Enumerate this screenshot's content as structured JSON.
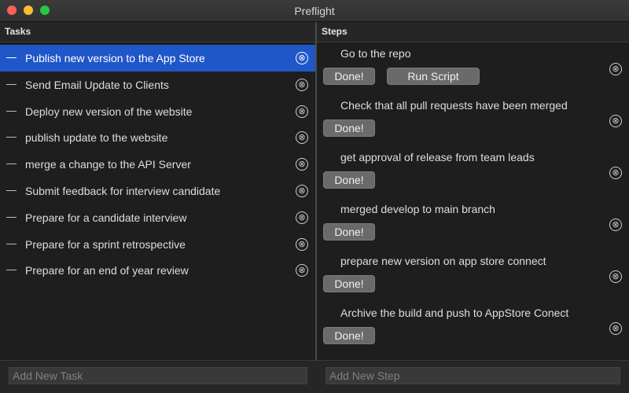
{
  "window": {
    "title": "Preflight"
  },
  "tasks_pane": {
    "header": "Tasks",
    "items": [
      {
        "label": "Publish new version to the App Store",
        "selected": true
      },
      {
        "label": "Send Email Update to Clients"
      },
      {
        "label": "Deploy new version of the website"
      },
      {
        "label": "publish update to the website"
      },
      {
        "label": "merge a change to the API Server"
      },
      {
        "label": "Submit feedback for interview candidate"
      },
      {
        "label": "Prepare for a candidate interview"
      },
      {
        "label": "Prepare for a sprint retrospective"
      },
      {
        "label": "Prepare for an end of year review"
      }
    ],
    "new_placeholder": "Add New Task"
  },
  "steps_pane": {
    "header": "Steps",
    "items": [
      {
        "label": "Go to the repo",
        "done_label": "Done!",
        "run_label": "Run Script"
      },
      {
        "label": "Check that all pull requests have been merged",
        "done_label": "Done!"
      },
      {
        "label": "get approval of release from team leads",
        "done_label": "Done!"
      },
      {
        "label": "merged develop to main branch",
        "done_label": "Done!"
      },
      {
        "label": "prepare new version on app store connect",
        "done_label": "Done!"
      },
      {
        "label": "Archive the build and push to AppStore Conect",
        "done_label": "Done!"
      }
    ],
    "new_placeholder": "Add New Step"
  },
  "icons": {
    "delete": "⊗"
  },
  "colors": {
    "selection": "#1f57c9",
    "background": "#1e1e1e"
  }
}
